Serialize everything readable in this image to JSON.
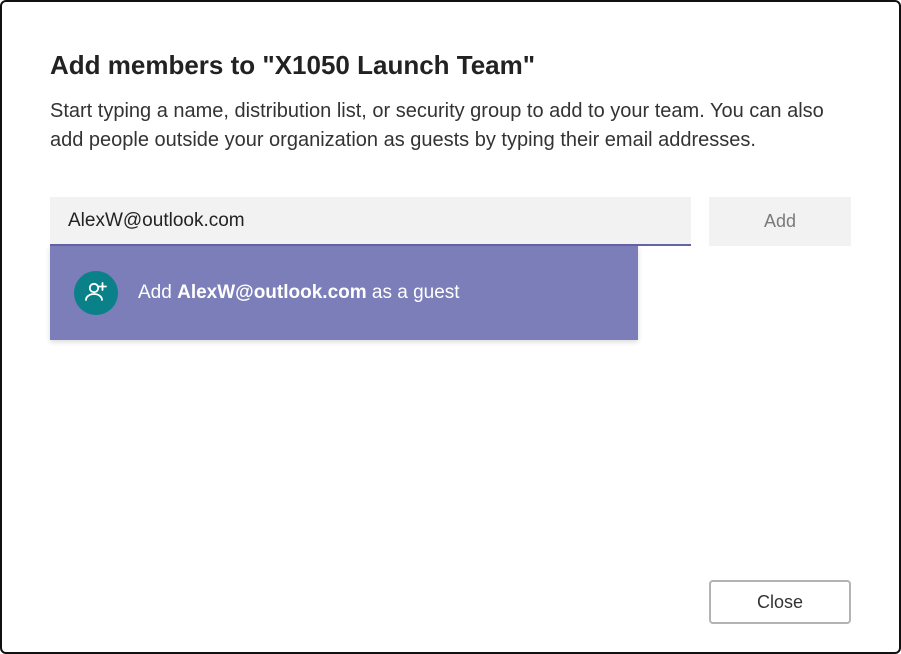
{
  "dialog": {
    "title": "Add members to \"X1050 Launch Team\"",
    "description": "Start typing a name, distribution list, or security group to add to your team. You can also add people outside your organization as guests by typing their email addresses.",
    "input_value": "AlexW@outlook.com",
    "input_placeholder": "",
    "add_button": "Add",
    "close_button": "Close"
  },
  "suggestion": {
    "prefix": "Add ",
    "email": "AlexW@outlook.com",
    "suffix": " as a guest",
    "icon": "add-guest-icon"
  },
  "colors": {
    "accent": "#6264a7",
    "suggestion_bg": "#7b7eb8",
    "icon_bg": "#0a8088"
  }
}
